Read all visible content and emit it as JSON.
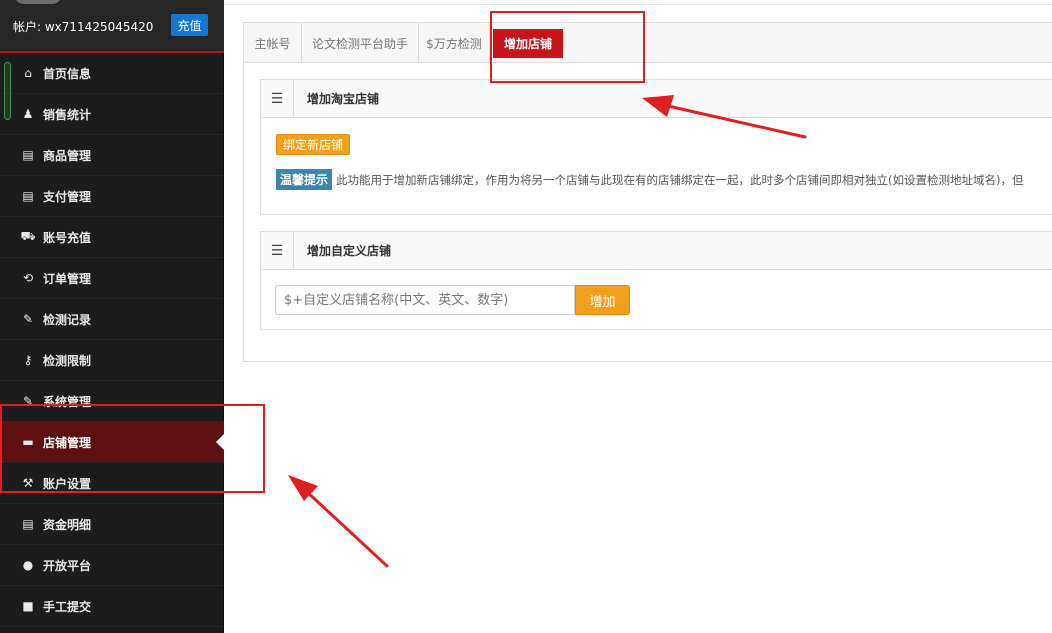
{
  "account": {
    "label": "帐户: wx711425045420",
    "recharge_label": "充值"
  },
  "sidebar": {
    "items": [
      {
        "label": "首页信息",
        "icon": "home-icon",
        "glyph": "⌂"
      },
      {
        "label": "销售统计",
        "icon": "user-icon",
        "glyph": "♟"
      },
      {
        "label": "商品管理",
        "icon": "card-icon",
        "glyph": "▤"
      },
      {
        "label": "支付管理",
        "icon": "card-icon",
        "glyph": "▤"
      },
      {
        "label": "账号充值",
        "icon": "cart-icon",
        "glyph": "⛟"
      },
      {
        "label": "订单管理",
        "icon": "refresh-icon",
        "glyph": "⟲"
      },
      {
        "label": "检测记录",
        "icon": "edit-icon",
        "glyph": "✎"
      },
      {
        "label": "检测限制",
        "icon": "key-icon",
        "glyph": "⚷"
      },
      {
        "label": "系统管理",
        "icon": "wrench-icon",
        "glyph": "✎"
      },
      {
        "label": "店铺管理",
        "icon": "hdd-icon",
        "glyph": "▬"
      },
      {
        "label": "账户设置",
        "icon": "gavel-icon",
        "glyph": "⚒"
      },
      {
        "label": "资金明细",
        "icon": "list-icon",
        "glyph": "▤"
      },
      {
        "label": "开放平台",
        "icon": "globe-icon",
        "glyph": "●"
      },
      {
        "label": "手工提交",
        "icon": "folder-icon",
        "glyph": "■"
      }
    ]
  },
  "tabs": [
    {
      "label": "主帐号"
    },
    {
      "label": "论文检测平台助手"
    },
    {
      "label": "$万方检测"
    },
    {
      "label": "增加店铺"
    }
  ],
  "taobao_box": {
    "title": "增加淘宝店铺",
    "bind_button": "绑定新店铺",
    "tip_badge": "温馨提示",
    "tip_text": "此功能用于增加新店铺绑定，作用为将另一个店铺与此现在有的店铺绑定在一起，此时多个店铺间即相对独立(如设置检测地址域名)，但"
  },
  "custom_box": {
    "title": "增加自定义店铺",
    "input_placeholder": "$+自定义店铺名称(中文、英文、数字)",
    "add_button": "增加"
  },
  "colors": {
    "accent_red": "#c8141b",
    "annotation_red": "#e02020",
    "button_orange": "#f0a01c",
    "recharge_blue": "#1677d2"
  }
}
